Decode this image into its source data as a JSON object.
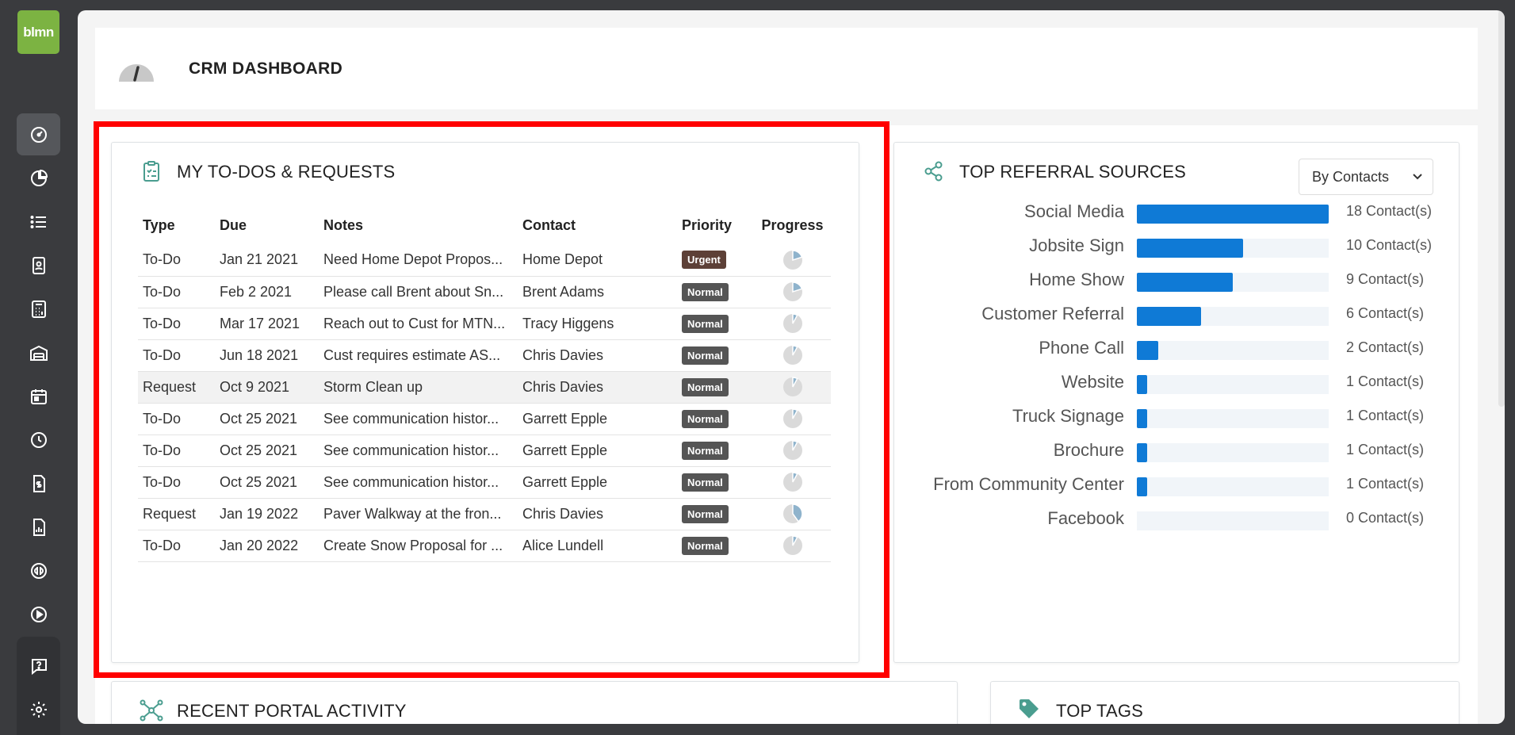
{
  "app": {
    "logo_text": "blmn"
  },
  "header": {
    "title": "CRM DASHBOARD"
  },
  "sidebar": {
    "items": [
      {
        "icon": "dashboard-icon",
        "active": true
      },
      {
        "icon": "pie-chart-icon"
      },
      {
        "icon": "list-icon"
      },
      {
        "icon": "contact-card-icon"
      },
      {
        "icon": "calculator-icon"
      },
      {
        "icon": "warehouse-icon"
      },
      {
        "icon": "calendar-icon"
      },
      {
        "icon": "clock-icon"
      },
      {
        "icon": "invoice-icon"
      },
      {
        "icon": "report-icon"
      },
      {
        "icon": "quickbooks-icon"
      },
      {
        "icon": "play-icon"
      },
      {
        "icon": "help-icon"
      },
      {
        "icon": "gear-icon"
      }
    ]
  },
  "todos": {
    "title": "MY TO-DOS & REQUESTS",
    "columns": [
      "Type",
      "Due",
      "Notes",
      "Contact",
      "Priority",
      "Progress"
    ],
    "rows": [
      {
        "type": "To-Do",
        "due": "Jan 21 2021",
        "notes": "Need Home Depot Propos...",
        "contact": "Home Depot",
        "priority": "Urgent",
        "progress": 0.2
      },
      {
        "type": "To-Do",
        "due": "Feb 2 2021",
        "notes": "Please call Brent about Sn...",
        "contact": "Brent Adams",
        "priority": "Normal",
        "progress": 0.2
      },
      {
        "type": "To-Do",
        "due": "Mar 17 2021",
        "notes": "Reach out to Cust for MTN...",
        "contact": "Tracy Higgens",
        "priority": "Normal",
        "progress": 0.08
      },
      {
        "type": "To-Do",
        "due": "Jun 18 2021",
        "notes": "Cust requires estimate AS...",
        "contact": "Chris Davies",
        "priority": "Normal",
        "progress": 0.08
      },
      {
        "type": "Request",
        "due": "Oct 9 2021",
        "notes": "Storm Clean up",
        "contact": "Chris Davies",
        "priority": "Normal",
        "progress": 0.08
      },
      {
        "type": "To-Do",
        "due": "Oct 25 2021",
        "notes": "See communication histor...",
        "contact": "Garrett Epple",
        "priority": "Normal",
        "progress": 0.08
      },
      {
        "type": "To-Do",
        "due": "Oct 25 2021",
        "notes": "See communication histor...",
        "contact": "Garrett Epple",
        "priority": "Normal",
        "progress": 0.08
      },
      {
        "type": "To-Do",
        "due": "Oct 25 2021",
        "notes": "See communication histor...",
        "contact": "Garrett Epple",
        "priority": "Normal",
        "progress": 0.08
      },
      {
        "type": "Request",
        "due": "Jan 19 2022",
        "notes": "Paver Walkway at the fron...",
        "contact": "Chris Davies",
        "priority": "Normal",
        "progress": 0.4
      },
      {
        "type": "To-Do",
        "due": "Jan 20 2022",
        "notes": "Create Snow Proposal for ...",
        "contact": "Alice Lundell",
        "priority": "Normal",
        "progress": 0.08
      }
    ]
  },
  "referrals": {
    "title": "TOP REFERRAL SOURCES",
    "select_value": "By Contacts",
    "max": 18,
    "items": [
      {
        "label": "Social Media",
        "value": 18,
        "count": "18 Contact(s)"
      },
      {
        "label": "Jobsite Sign",
        "value": 10,
        "count": "10 Contact(s)"
      },
      {
        "label": "Home Show",
        "value": 9,
        "count": "9 Contact(s)"
      },
      {
        "label": "Customer Referral",
        "value": 6,
        "count": "6 Contact(s)"
      },
      {
        "label": "Phone Call",
        "value": 2,
        "count": "2 Contact(s)"
      },
      {
        "label": "Website",
        "value": 1,
        "count": "1 Contact(s)"
      },
      {
        "label": "Truck Signage",
        "value": 1,
        "count": "1 Contact(s)"
      },
      {
        "label": "Brochure",
        "value": 1,
        "count": "1 Contact(s)"
      },
      {
        "label": "From Community Center",
        "value": 1,
        "count": "1 Contact(s)"
      },
      {
        "label": "Facebook",
        "value": 0,
        "count": "0 Contact(s)"
      }
    ]
  },
  "portal": {
    "title": "RECENT PORTAL ACTIVITY"
  },
  "tags": {
    "title": "TOP TAGS"
  },
  "colors": {
    "accent": "#0f7ad6",
    "brand": "#7cb342",
    "highlight": "#ff0000",
    "icon_teal": "#4a9d8f"
  }
}
